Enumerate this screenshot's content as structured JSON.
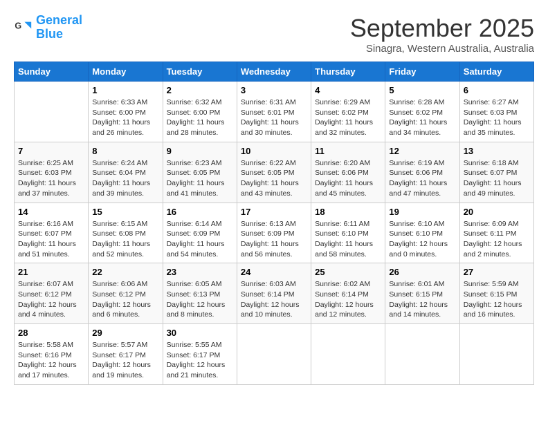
{
  "header": {
    "logo_line1": "General",
    "logo_line2": "Blue",
    "title": "September 2025",
    "subtitle": "Sinagra, Western Australia, Australia"
  },
  "calendar": {
    "days_of_week": [
      "Sunday",
      "Monday",
      "Tuesday",
      "Wednesday",
      "Thursday",
      "Friday",
      "Saturday"
    ],
    "weeks": [
      [
        {
          "day": "",
          "info": ""
        },
        {
          "day": "1",
          "info": "Sunrise: 6:33 AM\nSunset: 6:00 PM\nDaylight: 11 hours\nand 26 minutes."
        },
        {
          "day": "2",
          "info": "Sunrise: 6:32 AM\nSunset: 6:00 PM\nDaylight: 11 hours\nand 28 minutes."
        },
        {
          "day": "3",
          "info": "Sunrise: 6:31 AM\nSunset: 6:01 PM\nDaylight: 11 hours\nand 30 minutes."
        },
        {
          "day": "4",
          "info": "Sunrise: 6:29 AM\nSunset: 6:02 PM\nDaylight: 11 hours\nand 32 minutes."
        },
        {
          "day": "5",
          "info": "Sunrise: 6:28 AM\nSunset: 6:02 PM\nDaylight: 11 hours\nand 34 minutes."
        },
        {
          "day": "6",
          "info": "Sunrise: 6:27 AM\nSunset: 6:03 PM\nDaylight: 11 hours\nand 35 minutes."
        }
      ],
      [
        {
          "day": "7",
          "info": "Sunrise: 6:25 AM\nSunset: 6:03 PM\nDaylight: 11 hours\nand 37 minutes."
        },
        {
          "day": "8",
          "info": "Sunrise: 6:24 AM\nSunset: 6:04 PM\nDaylight: 11 hours\nand 39 minutes."
        },
        {
          "day": "9",
          "info": "Sunrise: 6:23 AM\nSunset: 6:05 PM\nDaylight: 11 hours\nand 41 minutes."
        },
        {
          "day": "10",
          "info": "Sunrise: 6:22 AM\nSunset: 6:05 PM\nDaylight: 11 hours\nand 43 minutes."
        },
        {
          "day": "11",
          "info": "Sunrise: 6:20 AM\nSunset: 6:06 PM\nDaylight: 11 hours\nand 45 minutes."
        },
        {
          "day": "12",
          "info": "Sunrise: 6:19 AM\nSunset: 6:06 PM\nDaylight: 11 hours\nand 47 minutes."
        },
        {
          "day": "13",
          "info": "Sunrise: 6:18 AM\nSunset: 6:07 PM\nDaylight: 11 hours\nand 49 minutes."
        }
      ],
      [
        {
          "day": "14",
          "info": "Sunrise: 6:16 AM\nSunset: 6:07 PM\nDaylight: 11 hours\nand 51 minutes."
        },
        {
          "day": "15",
          "info": "Sunrise: 6:15 AM\nSunset: 6:08 PM\nDaylight: 11 hours\nand 52 minutes."
        },
        {
          "day": "16",
          "info": "Sunrise: 6:14 AM\nSunset: 6:09 PM\nDaylight: 11 hours\nand 54 minutes."
        },
        {
          "day": "17",
          "info": "Sunrise: 6:13 AM\nSunset: 6:09 PM\nDaylight: 11 hours\nand 56 minutes."
        },
        {
          "day": "18",
          "info": "Sunrise: 6:11 AM\nSunset: 6:10 PM\nDaylight: 11 hours\nand 58 minutes."
        },
        {
          "day": "19",
          "info": "Sunrise: 6:10 AM\nSunset: 6:10 PM\nDaylight: 12 hours\nand 0 minutes."
        },
        {
          "day": "20",
          "info": "Sunrise: 6:09 AM\nSunset: 6:11 PM\nDaylight: 12 hours\nand 2 minutes."
        }
      ],
      [
        {
          "day": "21",
          "info": "Sunrise: 6:07 AM\nSunset: 6:12 PM\nDaylight: 12 hours\nand 4 minutes."
        },
        {
          "day": "22",
          "info": "Sunrise: 6:06 AM\nSunset: 6:12 PM\nDaylight: 12 hours\nand 6 minutes."
        },
        {
          "day": "23",
          "info": "Sunrise: 6:05 AM\nSunset: 6:13 PM\nDaylight: 12 hours\nand 8 minutes."
        },
        {
          "day": "24",
          "info": "Sunrise: 6:03 AM\nSunset: 6:14 PM\nDaylight: 12 hours\nand 10 minutes."
        },
        {
          "day": "25",
          "info": "Sunrise: 6:02 AM\nSunset: 6:14 PM\nDaylight: 12 hours\nand 12 minutes."
        },
        {
          "day": "26",
          "info": "Sunrise: 6:01 AM\nSunset: 6:15 PM\nDaylight: 12 hours\nand 14 minutes."
        },
        {
          "day": "27",
          "info": "Sunrise: 5:59 AM\nSunset: 6:15 PM\nDaylight: 12 hours\nand 16 minutes."
        }
      ],
      [
        {
          "day": "28",
          "info": "Sunrise: 5:58 AM\nSunset: 6:16 PM\nDaylight: 12 hours\nand 17 minutes."
        },
        {
          "day": "29",
          "info": "Sunrise: 5:57 AM\nSunset: 6:17 PM\nDaylight: 12 hours\nand 19 minutes."
        },
        {
          "day": "30",
          "info": "Sunrise: 5:55 AM\nSunset: 6:17 PM\nDaylight: 12 hours\nand 21 minutes."
        },
        {
          "day": "",
          "info": ""
        },
        {
          "day": "",
          "info": ""
        },
        {
          "day": "",
          "info": ""
        },
        {
          "day": "",
          "info": ""
        }
      ]
    ]
  }
}
